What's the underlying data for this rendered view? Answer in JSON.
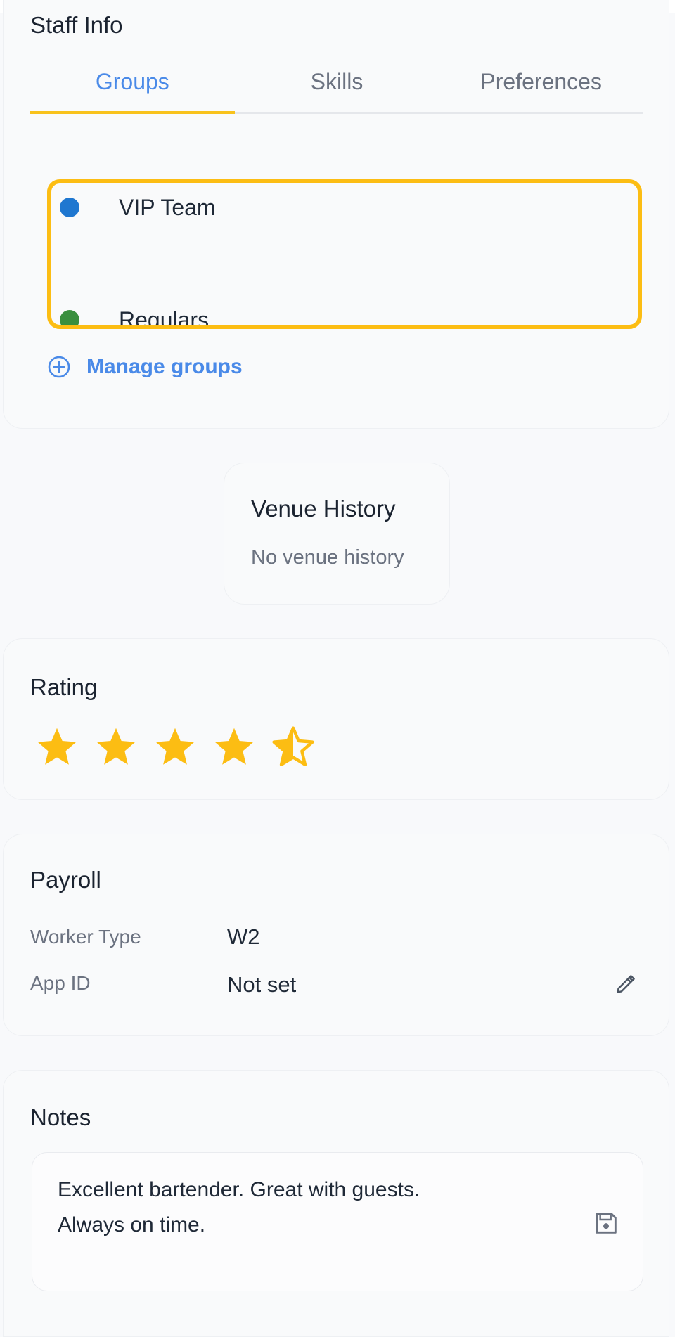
{
  "staff_info": {
    "title": "Staff Info",
    "tabs": [
      {
        "label": "Groups",
        "active": true
      },
      {
        "label": "Skills",
        "active": false
      },
      {
        "label": "Preferences",
        "active": false
      }
    ],
    "groups": [
      {
        "label": "VIP Team",
        "color": "#1f77d0"
      },
      {
        "label": "Regulars",
        "color": "#3a8f3e"
      }
    ],
    "manage_label": "Manage groups"
  },
  "venue_history": {
    "title": "Venue History",
    "empty_text": "No venue history"
  },
  "rating": {
    "title": "Rating",
    "value": 4.5,
    "max": 5,
    "star_color": "#fcbd13"
  },
  "payroll": {
    "title": "Payroll",
    "worker_type_label": "Worker Type",
    "worker_type_value": "W2",
    "app_id_label": "App ID",
    "app_id_value": "Not set"
  },
  "notes": {
    "title": "Notes",
    "text_line1": "Excellent bartender. Great with guests.",
    "text_line2": "Always on time."
  },
  "colors": {
    "accent": "#4a8ae8",
    "highlight": "#fcbd13",
    "tab_indicator": "#f8c21c"
  }
}
